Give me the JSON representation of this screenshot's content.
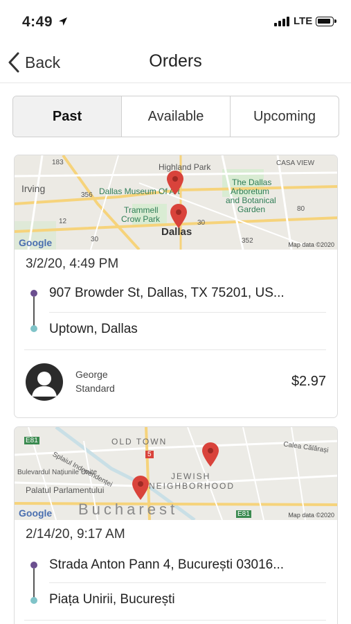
{
  "status_bar": {
    "time": "4:49",
    "network": "LTE",
    "location_icon": "location-arrow-icon",
    "signal_icon": "signal-bars-icon",
    "battery_icon": "battery-icon"
  },
  "nav": {
    "back_label": "Back",
    "title": "Orders",
    "back_icon": "chevron-left-icon"
  },
  "tabs": [
    {
      "label": "Past",
      "active": true
    },
    {
      "label": "Available",
      "active": false
    },
    {
      "label": "Upcoming",
      "active": false
    }
  ],
  "orders": [
    {
      "map": {
        "labels": [
          "Highland Park",
          "CASA VIEW",
          "Irving",
          "Dallas Museum Of Art",
          "The Dallas",
          "Arboretum",
          "and Botanical",
          "Garden",
          "Trammell",
          "Crow Park",
          "Dallas",
          "183",
          "356",
          "12",
          "30",
          "30",
          "80",
          "352"
        ],
        "google": "Google",
        "map_data": "Map data ©2020"
      },
      "datetime": "3/2/20, 4:49 PM",
      "pickup": "907 Browder St, Dallas, TX 75201, US...",
      "dropoff": "Uptown, Dallas",
      "driver_name": "George",
      "service": "Standard",
      "price": "$2.97",
      "avatar_icon": "person-avatar-icon"
    },
    {
      "map": {
        "labels": [
          "OLD TOWN",
          "Calea Călărași",
          "Splaiul Independenței",
          "Bulevardul Națiunile Unite",
          "JEWISH",
          "NEIGHBORHOOD",
          "Palatul Parlamentului",
          "Bucharest",
          "E81",
          "E81",
          "5"
        ],
        "google": "Google",
        "map_data": "Map data ©2020"
      },
      "datetime": "2/14/20, 9:17 AM",
      "pickup": "Strada Anton Pann 4, București 03016...",
      "dropoff": "Piața Unirii, București"
    }
  ],
  "colors": {
    "pickup_dot": "#6b4f8f",
    "dropoff_dot": "#7fc3c8",
    "pin": "#d9433b",
    "active_tab_bg": "#f1f1f1"
  }
}
